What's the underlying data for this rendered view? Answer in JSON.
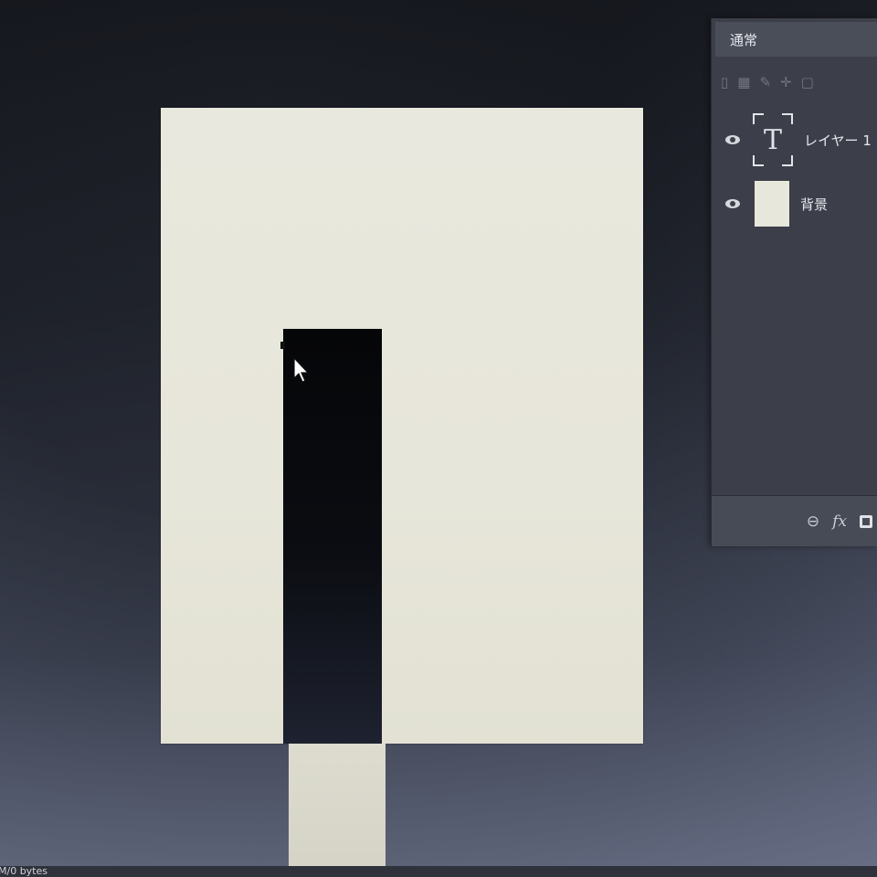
{
  "layers_panel": {
    "blend_mode": "通常",
    "lock_icons": [
      "pixel-lock-icon",
      "brush-icon",
      "move-icon",
      "artboard-icon"
    ],
    "layers": [
      {
        "name": "レイヤー 1",
        "type": "text",
        "thumb_glyph": "T",
        "visible": true
      },
      {
        "name": "背景",
        "type": "background",
        "visible": true
      }
    ],
    "footer_fx": "fx"
  },
  "status_bar": {
    "text": "M/0 bytes"
  },
  "colors": {
    "canvas": "#e9e8de",
    "bar": "#050608",
    "panel": "#3c3f49"
  }
}
